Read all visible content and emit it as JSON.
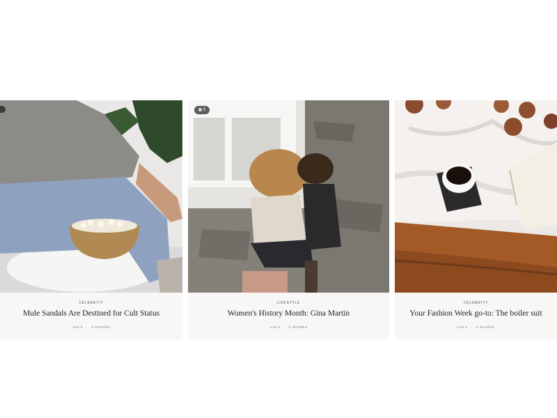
{
  "cards": [
    {
      "category": "Celebrity",
      "title": "Mule Sandals Are Destined for Cult Status",
      "date": "JAN 3",
      "shares": "0 SHARES"
    },
    {
      "category": "Lifestyle",
      "title": "Women's History Month: Gina Martin",
      "date": "JAN 3",
      "shares": "0 SHARES",
      "gallery_badge": "5"
    },
    {
      "category": "Celebrity",
      "title": "Your Fashion Week go-to: The boiler suit",
      "date": "JAN 3",
      "shares": "0 SHARES"
    }
  ],
  "icons": {
    "gallery": "gallery-icon",
    "prev": "chevron-left-icon"
  }
}
